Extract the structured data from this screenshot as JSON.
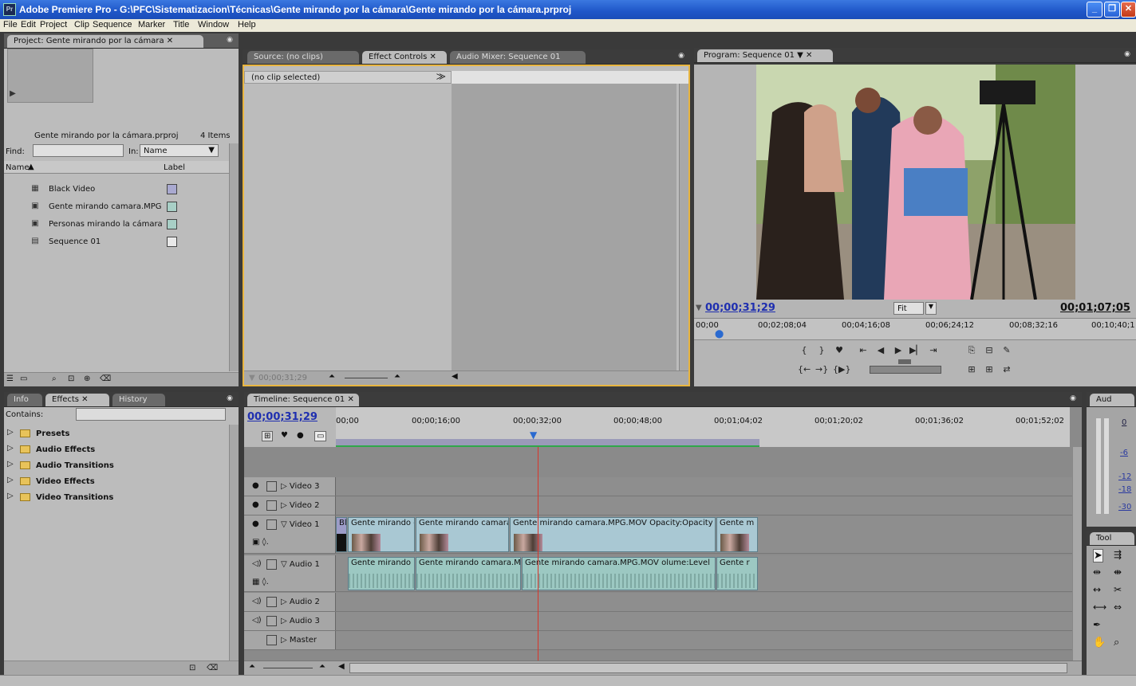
{
  "window": {
    "title": "Adobe Premiere Pro - G:\\PFC\\Sistematizacion\\Técnicas\\Gente mirando por la cámara\\Gente mirando por la cámara.prproj",
    "logo": "Pr",
    "controls": [
      "minimize-icon",
      "restore-icon",
      "close-icon"
    ]
  },
  "menu": [
    "File",
    "Edit",
    "Project",
    "Clip",
    "Sequence",
    "Marker",
    "Title",
    "Window",
    "Help"
  ],
  "project": {
    "tab": "Project: Gente mirando por la cámara",
    "file": "Gente mirando por la cámara.prproj",
    "count": "4 Items",
    "find_label": "Find:",
    "in_label": "In:",
    "in_value": "Name",
    "col_name": "Name",
    "col_label": "Label",
    "items": [
      {
        "name": "Black Video",
        "color": "#a9a9d0"
      },
      {
        "name": "Gente mirando camara.MPG",
        "color": "#a8cfc6"
      },
      {
        "name": "Personas mirando la cámara",
        "color": "#a8cfc6"
      },
      {
        "name": "Sequence 01",
        "color": "#e8e8e8"
      }
    ]
  },
  "source": {
    "tabs": [
      "Source: (no clips)",
      "Effect Controls",
      "Audio Mixer: Sequence 01"
    ],
    "no_clip": "(no clip selected)",
    "timecode": "00;00;31;29"
  },
  "program": {
    "tab": "Program: Sequence 01",
    "timecode": "00;00;31;29",
    "duration": "00;01;07;05",
    "fit": "Fit",
    "ruler": [
      "00;00",
      "00;02;08;04",
      "00;04;16;08",
      "00;06;24;12",
      "00;08;32;16",
      "00;10;40;1"
    ]
  },
  "effects": {
    "tabs": [
      "Info",
      "Effects",
      "History"
    ],
    "contains_label": "Contains:",
    "folders": [
      "Presets",
      "Audio Effects",
      "Audio Transitions",
      "Video Effects",
      "Video Transitions"
    ]
  },
  "timeline": {
    "tab": "Timeline: Sequence 01",
    "timecode": "00;00;31;29",
    "ruler": [
      "00;00",
      "00;00;16;00",
      "00;00;32;00",
      "00;00;48;00",
      "00;01;04;02",
      "00;01;20;02",
      "00;01;36;02",
      "00;01;52;02"
    ],
    "video_tracks": [
      "Video 3",
      "Video 2",
      "Video 1"
    ],
    "audio_tracks": [
      "Audio 1",
      "Audio 2",
      "Audio 3",
      "Master"
    ],
    "v1_clips": [
      "Bl",
      "Gente mirando c",
      "Gente mirando camara.",
      "Gente mirando camara.MPG.MOV  Opacity:Opacity",
      "Gente m"
    ],
    "a1_clips": [
      "Gente mirando",
      "Gente mirando camara.M",
      "Gente mirando camara.MPG.MOV  olume:Level",
      "Gente r"
    ],
    "playhead_fraction": 0.27
  },
  "audio_meter": {
    "tab": "Aud",
    "labels": [
      "0",
      "-6",
      "-12",
      "-18",
      "-30"
    ]
  },
  "tools": {
    "tab": "Tool"
  }
}
